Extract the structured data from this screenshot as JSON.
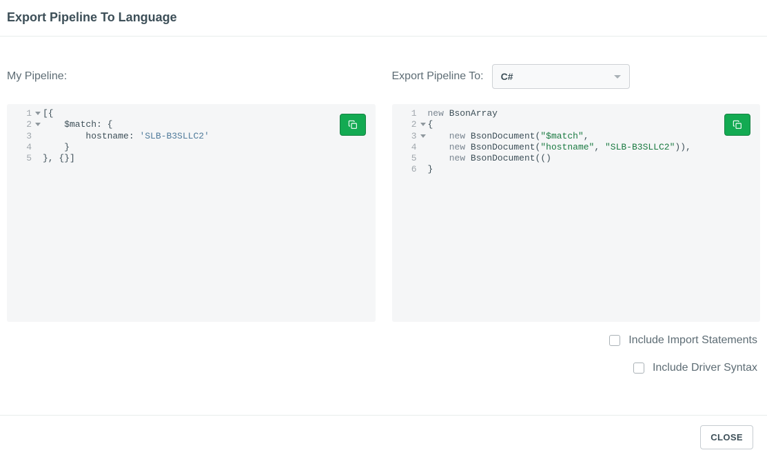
{
  "dialog": {
    "title": "Export Pipeline To Language"
  },
  "left": {
    "label": "My Pipeline:",
    "lines": [
      "1",
      "2",
      "3",
      "4",
      "5"
    ],
    "code_plain": "[{\n    $match: {\n        hostname: 'SLB-B3SLLC2'\n    }\n}, {}]",
    "tokens": {
      "l1_a": "[{",
      "l2_a": "    $match: {",
      "l3_a": "        hostname: ",
      "l3_b": "'SLB-B3SLLC2'",
      "l4_a": "    }",
      "l5_a": "}, {}]"
    }
  },
  "right": {
    "label": "Export Pipeline To:",
    "select_value": "C#",
    "lines": [
      "1",
      "2",
      "3",
      "4",
      "5",
      "6"
    ],
    "code_plain": "new BsonArray\n{\n    new BsonDocument(\"$match\",\n    new BsonDocument(\"hostname\", \"SLB-B3SLLC2\")),\n    new BsonDocument()\n}",
    "tokens": {
      "kw_new": "new",
      "t_array": " BsonArray",
      "l2": "{",
      "t_doc": " BsonDocument(",
      "s_match": "\"$match\"",
      "comma": ",",
      "s_hostname": "\"hostname\"",
      "comma_sp": ", ",
      "s_val": "\"SLB-B3SLLC2\"",
      "close2": ")),",
      "close0": "()",
      "l6": "}",
      "pad": "    "
    }
  },
  "options": {
    "imports_label": "Include Import Statements",
    "driver_label": "Include Driver Syntax"
  },
  "footer": {
    "close_label": "CLOSE"
  }
}
